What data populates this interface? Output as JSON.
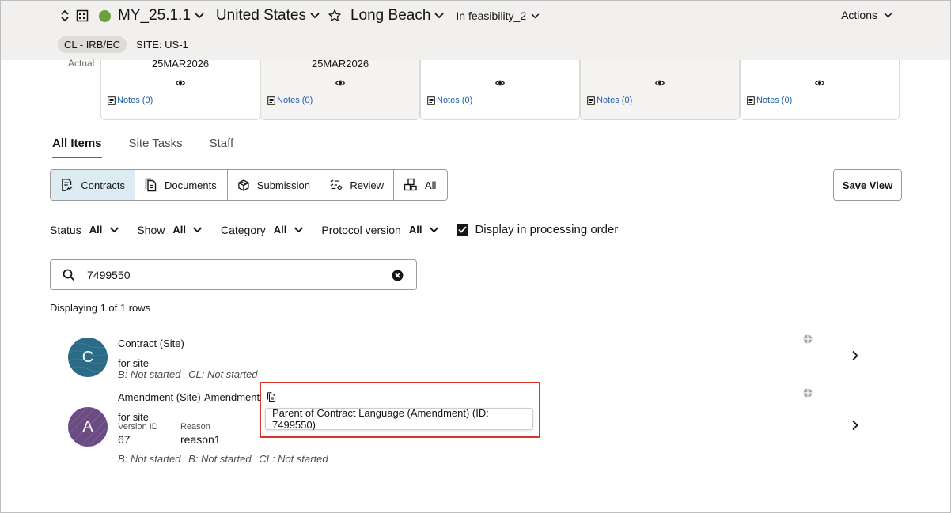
{
  "header": {
    "study_name": "MY_25.1.1",
    "country": "United States",
    "site_name": "Long Beach",
    "site_status": "In feasibility_2",
    "actions_label": "Actions",
    "chip_label": "CL - IRB/EC",
    "site_label": "SITE: US-1",
    "status_color": "#6aa13a"
  },
  "milestones": {
    "actual_label": "Actual",
    "cards": [
      {
        "date": "25MAR2026",
        "notes": "Notes (0)"
      },
      {
        "date": "25MAR2026",
        "notes": "Notes (0)"
      },
      {
        "date": "",
        "notes": "Notes (0)"
      },
      {
        "date": "",
        "notes": "Notes (0)"
      },
      {
        "date": "",
        "notes": "Notes (0)"
      }
    ]
  },
  "tabs": [
    "All Items",
    "Site Tasks",
    "Staff"
  ],
  "segments": [
    "Contracts",
    "Documents",
    "Submission",
    "Review",
    "All"
  ],
  "save_view_label": "Save View",
  "filters": {
    "status_label": "Status",
    "status_value": "All",
    "show_label": "Show",
    "show_value": "All",
    "category_label": "Category",
    "category_value": "All",
    "protocol_label": "Protocol version",
    "protocol_value": "All",
    "processing_label": "Display in processing order"
  },
  "search": {
    "value": "7499550"
  },
  "row_count": "Displaying 1 of 1 rows",
  "items": [
    {
      "avatar": "C",
      "title": "Contract (Site)",
      "for": "for site",
      "status_1": "B: Not started",
      "status_2": "CL: Not started"
    },
    {
      "avatar": "A",
      "title": "Amendment (Site)",
      "title_2": "Amendment",
      "for": "for site",
      "version_label": "Version ID",
      "version_value": "67",
      "reason_label": "Reason",
      "reason_value": "reason1",
      "status_1": "B: Not started",
      "status_2": "B: Not started",
      "status_3": "CL: Not started"
    }
  ],
  "tooltip": "Parent of Contract Language (Amendment) (ID: 7499550)"
}
